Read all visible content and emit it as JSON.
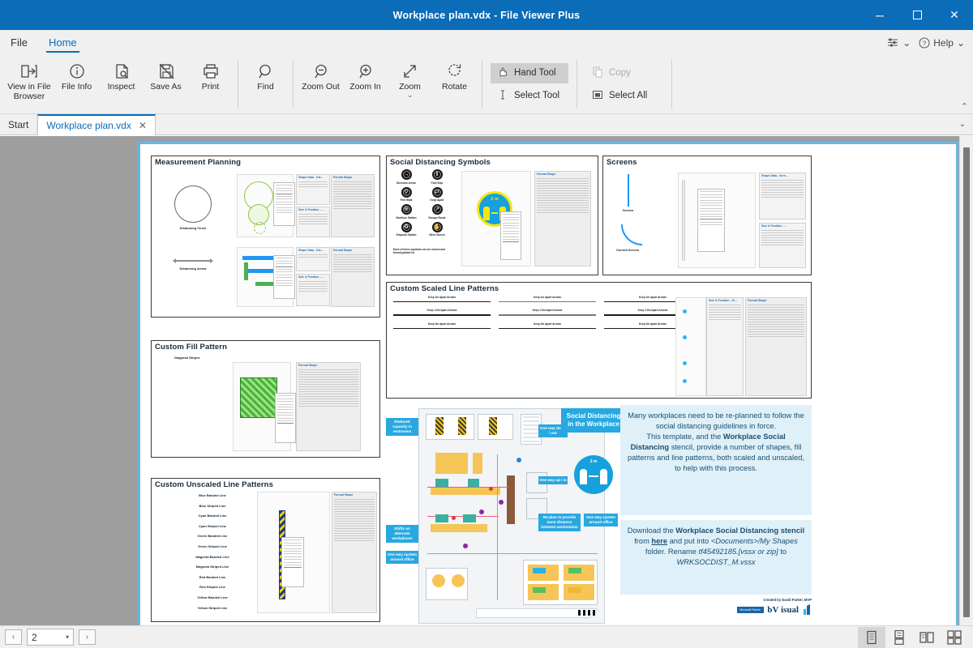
{
  "window": {
    "title": "Workplace plan.vdx - File Viewer Plus",
    "minimize": "─",
    "maximize": "☐",
    "close": "✕"
  },
  "menu": {
    "items": [
      {
        "label": "File",
        "active": false
      },
      {
        "label": "Home",
        "active": true
      }
    ],
    "settings_caret": "⌄",
    "help_label": "Help",
    "help_caret": "⌄"
  },
  "ribbon": {
    "buttons": [
      {
        "label": "View in File Browser",
        "icon": "view-in-file-browser-icon"
      },
      {
        "label": "File Info",
        "icon": "info-icon"
      },
      {
        "label": "Inspect",
        "icon": "inspect-icon"
      },
      {
        "label": "Save As",
        "icon": "save-as-icon"
      },
      {
        "label": "Print",
        "icon": "print-icon"
      },
      {
        "label": "Find",
        "icon": "find-icon"
      },
      {
        "label": "Zoom Out",
        "icon": "zoom-out-icon"
      },
      {
        "label": "Zoom In",
        "icon": "zoom-in-icon"
      },
      {
        "label": "Zoom",
        "icon": "zoom-fit-icon",
        "caret": "⌄"
      },
      {
        "label": "Rotate",
        "icon": "rotate-icon"
      }
    ],
    "tools": [
      {
        "label": "Hand Tool",
        "icon": "hand-icon",
        "selected": true,
        "disabled": false
      },
      {
        "label": "Select Tool",
        "icon": "text-cursor-icon",
        "selected": false,
        "disabled": false
      }
    ],
    "clipboard": [
      {
        "label": "Copy",
        "icon": "copy-icon",
        "selected": false,
        "disabled": true
      },
      {
        "label": "Select All",
        "icon": "select-all-icon",
        "selected": false,
        "disabled": false
      }
    ],
    "collapse_caret": "⌃"
  },
  "doctabs": {
    "tabs": [
      {
        "label": "Start",
        "active": false,
        "closable": false
      },
      {
        "label": "Workplace plan.vdx",
        "active": true,
        "closable": true,
        "close": "✕"
      }
    ],
    "overflow_caret": "⌄"
  },
  "document": {
    "panels": {
      "measurement_planning": {
        "title": "Measurement Planning",
        "shapes": [
          {
            "label": "Distancing Circle"
          },
          {
            "label": "Distancing Arrow"
          }
        ],
        "dialog_titles": [
          "Shape Data - Dis...",
          "Format Shape",
          "Size & Position - ...",
          "Shape Data - Dis...",
          "Format Shape",
          "Size & Position - ..."
        ]
      },
      "custom_fill_pattern": {
        "title": "Custom Fill Pattern",
        "shape_label": "Diagonal Stripes",
        "dialog_title": "Format Shape"
      },
      "custom_unscaled_line_patterns": {
        "title": "Custom Unscaled Line Patterns",
        "dialog_title": "Format Shape",
        "lines": [
          "Blue Banded Line",
          "Blue Striped Line",
          "Cyan Banded Line",
          "Cyan Striped Line",
          "Green Banded Line",
          "Green Striped Line",
          "Magenta Banded Line",
          "Magenta Striped Line",
          "Red Banded Line",
          "Red Striped Line",
          "Yellow Banded Line",
          "Yellow Striped Line"
        ]
      },
      "social_distancing_symbols": {
        "title": "Social Distancing Symbols",
        "symbols": [
          "Direction Arrow",
          "Foot Step",
          "Feet Walk",
          "Keep Apart",
          "Sanitiser Station",
          "Escape Route",
          "Disposal Station",
          "Wear Gloves"
        ],
        "note": "Each of these symbols can be resized and format-painter'ed",
        "sign_text": "2 m",
        "dialog_title": "Format Shape"
      },
      "screens": {
        "title": "Screens",
        "shapes": [
          {
            "label": "Screen"
          },
          {
            "label": "Curved Screen"
          }
        ],
        "dialog_titles": [
          "Shape Data - Scre...",
          "Size & Position - ..."
        ]
      },
      "custom_scaled_line_patterns": {
        "title": "Custom Scaled Line Patterns",
        "row_labels": [
          [
            "Keep 1m Apart Arrows",
            "Keep 1m Apart Arrows",
            "Keep 1m Apart Arrows"
          ],
          [
            "Keep 1.5m Apart Arrows",
            "Keep 1.5m Apart Arrows",
            "Keep 1.5m Apart Arrows"
          ],
          [
            "Keep 2m Apart Arrows",
            "Keep 2m Apart Arrows",
            "Keep 2m Apart Arrows"
          ]
        ],
        "dialog_titles": [
          "Size & Position - St...",
          "Format Shape"
        ]
      }
    },
    "floorplan": {
      "heading": "Social Distancing in the Workplace",
      "sign_text": "2 m",
      "callouts": [
        "Reduced capacity in restrooms",
        "One way down \\ out",
        "One way up / in",
        "Re-plan to provide more distance between workstation",
        "One way system around office",
        "Shifts on alternate workplaces",
        "One way system around office"
      ]
    },
    "info_panel": {
      "paragraph1_a": "Many workplaces need to be re-planned to follow the social distancing guidelines in force.",
      "paragraph1_b_pre": "This template, and the ",
      "paragraph1_b_bold": "Workplace Social Distancing",
      "paragraph1_b_post": " stencil, provide a number of shapes, fill patterns and line patterns, both scaled and unscaled, to help with this process.",
      "paragraph2_pre": "Download the ",
      "paragraph2_bold": "Workplace Social Distancing stencil",
      "paragraph2_mid": " from ",
      "paragraph2_link": "here",
      "paragraph2_post": " and put into ",
      "paragraph2_italic1": "<Documents>/My Shapes",
      "paragraph2_post2": " folder. Rename ",
      "paragraph2_italic2": "tf45492185.[vssx or zip]",
      "paragraph2_post3": " to ",
      "paragraph2_italic3": "WRKSOCDIST_M.vssx",
      "credit": "Created by David Parker, MVP",
      "brand": "bV isual",
      "brand_badge": "Microsoft Partner"
    }
  },
  "statusbar": {
    "prev_label": "‹",
    "next_label": "›",
    "page_value": "2",
    "page_caret": "▾",
    "views": [
      {
        "name": "single-page-view",
        "on": true
      },
      {
        "name": "continuous-page-view",
        "on": false
      },
      {
        "name": "two-page-view",
        "on": false
      },
      {
        "name": "two-page-continuous-view",
        "on": false
      }
    ]
  },
  "colors": {
    "titlebar": "#0b6cb8",
    "accent": "#0b6cb8",
    "page_border": "#69b6e8",
    "callout": "#28a8e0",
    "infobox": "#dff0f8",
    "workspace": "#9e9e9e"
  }
}
